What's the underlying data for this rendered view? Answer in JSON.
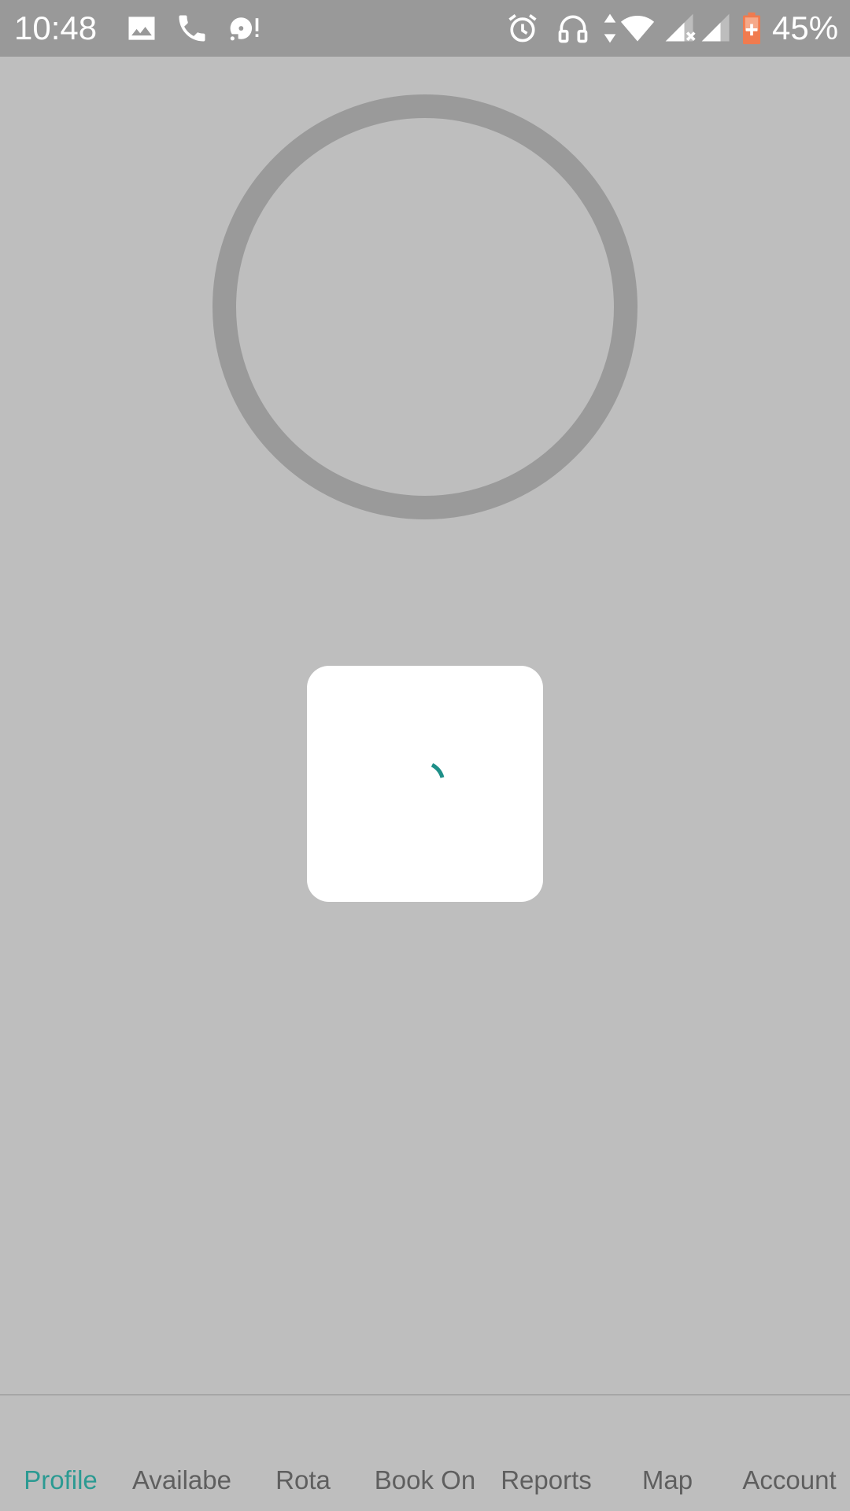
{
  "status_bar": {
    "time": "10:48",
    "battery_percent": "45%",
    "icons": [
      "image-icon",
      "phone-icon",
      "disc-alert-icon",
      "alarm-icon",
      "headphones-icon",
      "data-arrows-icon",
      "wifi-icon",
      "signal-no-service-icon",
      "signal-icon",
      "battery-charging-icon"
    ],
    "battery_color": "#f07b4f"
  },
  "avatar": {
    "ring_color": "#9a9a9a"
  },
  "loading": {
    "spinner_color": "#1e8f88"
  },
  "tabs": [
    {
      "label": "Profile",
      "active": true
    },
    {
      "label": "Availabe",
      "active": false
    },
    {
      "label": "Rota",
      "active": false
    },
    {
      "label": "Book On",
      "active": false
    },
    {
      "label": "Reports",
      "active": false
    },
    {
      "label": "Map",
      "active": false
    },
    {
      "label": "Account",
      "active": false
    }
  ],
  "colors": {
    "overlay_background": "#bebebe",
    "status_bar_background": "#999999",
    "active_tab": "#2b9a92",
    "inactive_tab": "#5f5f5f"
  }
}
